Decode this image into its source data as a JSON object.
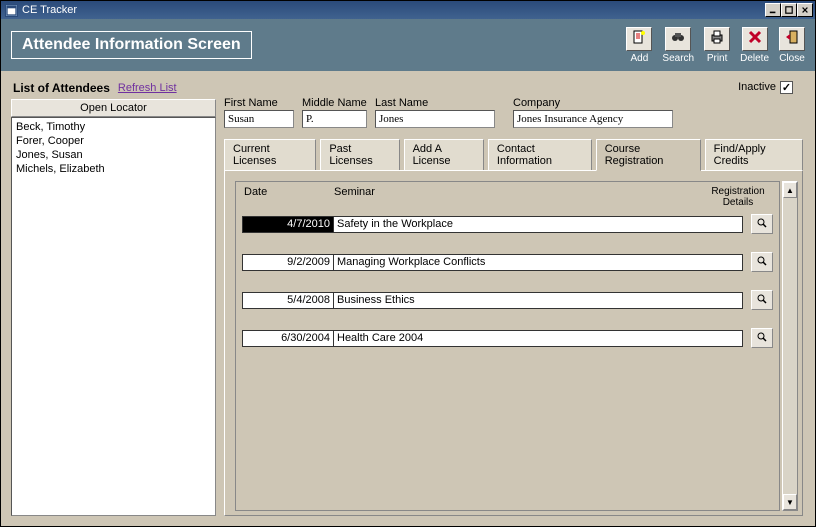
{
  "window": {
    "title": "CE Tracker"
  },
  "header": {
    "title": "Attendee Information Screen"
  },
  "toolbar": {
    "add": "Add",
    "search": "Search",
    "print": "Print",
    "delete": "Delete",
    "close": "Close"
  },
  "left": {
    "title": "List of Attendees",
    "refresh": "Refresh List",
    "locator": "Open Locator",
    "attendees": [
      "Beck, Timothy",
      "Forer, Cooper",
      "Jones, Susan",
      "Michels, Elizabeth"
    ]
  },
  "form": {
    "inactive_label": "Inactive",
    "inactive_checked": true,
    "first_name_label": "First Name",
    "first_name": "Susan",
    "middle_name_label": "Middle Name",
    "middle_name": "P.",
    "last_name_label": "Last Name",
    "last_name": "Jones",
    "company_label": "Company",
    "company": "Jones Insurance Agency"
  },
  "tabs": {
    "current_licenses": "Current Licenses",
    "past_licenses": "Past Licenses",
    "add_license": "Add A License",
    "contact_info": "Contact Information",
    "course_reg": "Course Registration",
    "find_credits": "Find/Apply Credits",
    "active": "course_reg"
  },
  "grid": {
    "col_date": "Date",
    "col_seminar": "Seminar",
    "col_details": "Registration\nDetails",
    "rows": [
      {
        "date": "4/7/2010",
        "seminar": "Safety in the Workplace",
        "selected": true
      },
      {
        "date": "9/2/2009",
        "seminar": "Managing Workplace Conflicts",
        "selected": false
      },
      {
        "date": "5/4/2008",
        "seminar": "Business Ethics",
        "selected": false
      },
      {
        "date": "6/30/2004",
        "seminar": "Health Care 2004",
        "selected": false
      }
    ]
  }
}
